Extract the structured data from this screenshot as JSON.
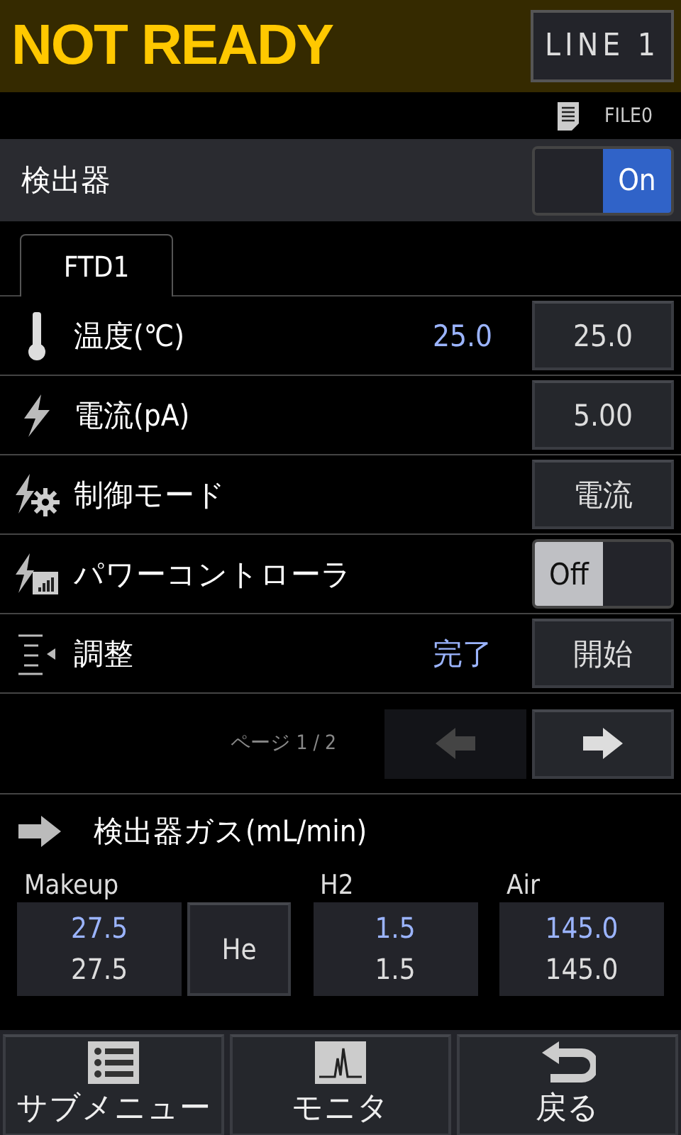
{
  "header": {
    "status": "NOT READY",
    "line_button": "LINE 1"
  },
  "file": {
    "name": "FILE0"
  },
  "detector": {
    "label": "検出器",
    "on": true,
    "toggle_text": "On"
  },
  "tabs": [
    {
      "label": "FTD1",
      "selected": true
    }
  ],
  "rows": [
    {
      "kind": "setpoint",
      "label": "温度(℃)",
      "actual": "25.0",
      "value": "25.0"
    },
    {
      "kind": "setpoint",
      "label": "電流(pA)",
      "value": "5.00"
    },
    {
      "kind": "choice",
      "label": "制御モード",
      "value": "電流"
    },
    {
      "kind": "toggle",
      "label": "パワーコントローラ",
      "on": false,
      "toggle_text": "Off"
    },
    {
      "kind": "action",
      "label": "調整",
      "status": "完了",
      "value": "開始"
    }
  ],
  "pager": {
    "text": "ページ 1 / 2",
    "prev_disabled": true,
    "next_disabled": false
  },
  "gas": {
    "title": "検出器ガス(mL/min)",
    "items": [
      {
        "label": "Makeup",
        "actual": "27.5",
        "set": "27.5",
        "gas_type": "He"
      },
      {
        "label": "H2",
        "actual": "1.5",
        "set": "1.5"
      },
      {
        "label": "Air",
        "actual": "145.0",
        "set": "145.0"
      }
    ]
  },
  "nav": [
    {
      "label": "サブメニュー"
    },
    {
      "label": "モニタ"
    },
    {
      "label": "戻る"
    }
  ]
}
